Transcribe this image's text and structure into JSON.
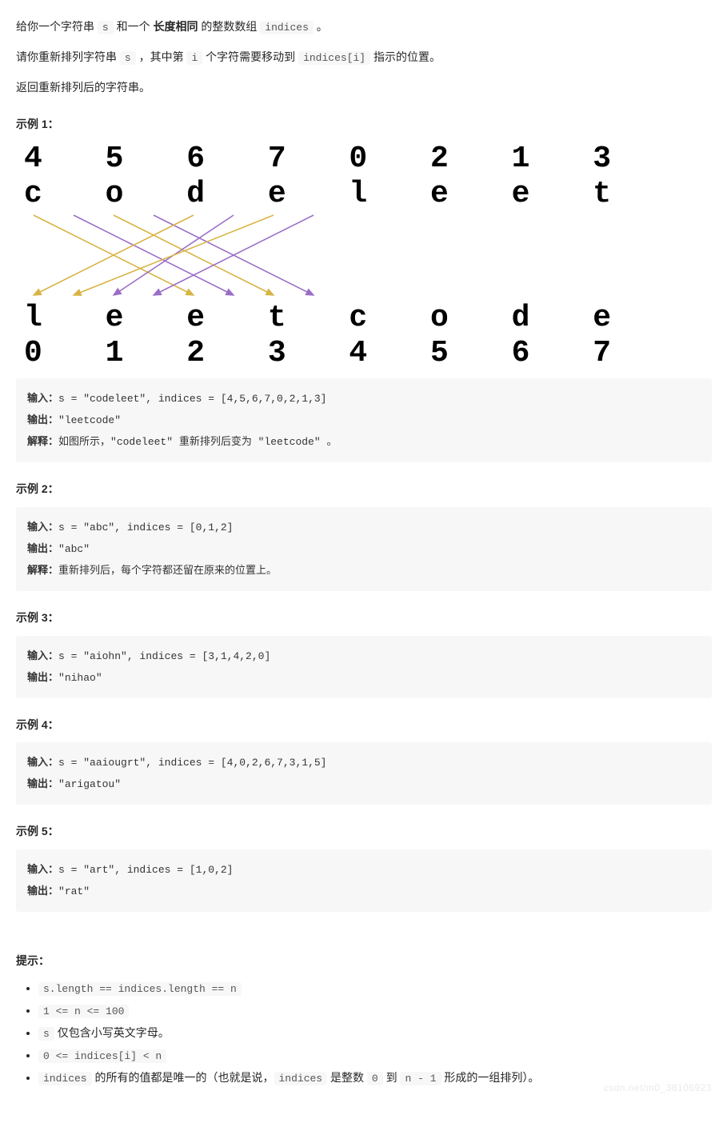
{
  "intro": {
    "line1_pre": "给你一个字符串 ",
    "s_code": "s",
    "line1_mid": " 和一个 ",
    "bold1": "长度相同",
    "line1_post": " 的整数数组 ",
    "indices_code": "indices",
    "line1_end": " 。",
    "line2_a": "请你重新排列字符串 ",
    "line2_b": " ，其中第 ",
    "i_code": "i",
    "line2_c": " 个字符需要移动到 ",
    "indices_i_code": "indices[i]",
    "line2_d": " 指示的位置。",
    "line3": "返回重新排列后的字符串。"
  },
  "labels": {
    "input": "输入：",
    "output": "输出：",
    "explain": "解释：",
    "hints": "提示："
  },
  "diagram": {
    "topNums": "4 5 6 7 0 2 1 3",
    "topChars": "c o d e l e e t",
    "botChars": "l e e t c o d e",
    "botNums": "0 1 2 3 4 5 6 7"
  },
  "examples": [
    {
      "title": "示例 1：",
      "input": "s = \"codeleet\", indices = [4,5,6,7,0,2,1,3]",
      "output": "\"leetcode\"",
      "explain": "如图所示，\"codeleet\" 重新排列后变为 \"leetcode\" 。"
    },
    {
      "title": "示例 2：",
      "input": "s = \"abc\", indices = [0,1,2]",
      "output": "\"abc\"",
      "explain": "重新排列后，每个字符都还留在原来的位置上。"
    },
    {
      "title": "示例 3：",
      "input": "s = \"aiohn\", indices = [3,1,4,2,0]",
      "output": "\"nihao\""
    },
    {
      "title": "示例 4：",
      "input": "s = \"aaiougrt\", indices = [4,0,2,6,7,3,1,5]",
      "output": "\"arigatou\""
    },
    {
      "title": "示例 5：",
      "input": "s = \"art\", indices = [1,0,2]",
      "output": "\"rat\""
    }
  ],
  "hints": {
    "h1": "s.length == indices.length == n",
    "h2": "1 <= n <= 100",
    "h3_a": "s",
    "h3_b": " 仅包含小写英文字母。",
    "h4": "0 <= indices[i] < n",
    "h5_a": "indices",
    "h5_b": " 的所有的值都是唯一的（也就是说，",
    "h5_c": "indices",
    "h5_d": " 是整数 ",
    "h5_e": "0",
    "h5_f": " 到 ",
    "h5_g": "n - 1",
    "h5_h": " 形成的一组排列）。"
  },
  "watermark": "csdn.net/m0_38106923"
}
